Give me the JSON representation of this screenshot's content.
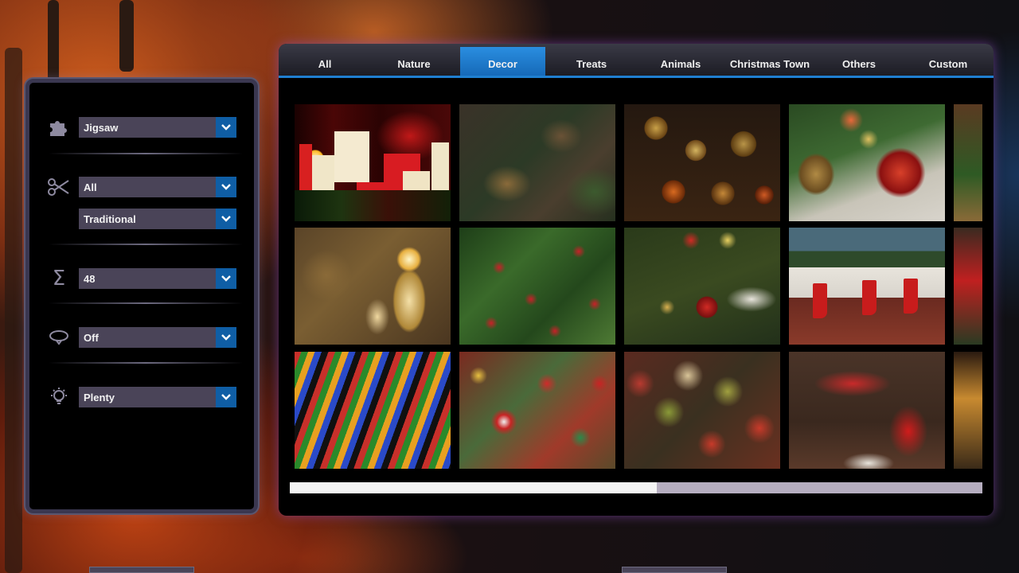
{
  "settings": {
    "mode": {
      "icon": "puzzle-piece-icon",
      "value": "Jigsaw"
    },
    "cut_group": {
      "icon": "scissors-icon",
      "value": "All"
    },
    "cut_style": {
      "value": "Traditional"
    },
    "pieces": {
      "icon": "sigma-icon",
      "value": "48"
    },
    "rotation": {
      "icon": "rotate-icon",
      "value": "Off"
    },
    "hints": {
      "icon": "lightbulb-icon",
      "value": "Plenty"
    }
  },
  "tabs": [
    {
      "label": "All",
      "active": false
    },
    {
      "label": "Nature",
      "active": false
    },
    {
      "label": "Decor",
      "active": true
    },
    {
      "label": "Treats",
      "active": false
    },
    {
      "label": "Animals",
      "active": false
    },
    {
      "label": "Christmas Town",
      "active": false
    },
    {
      "label": "Others",
      "active": false
    },
    {
      "label": "Custom",
      "active": false
    }
  ],
  "puzzles": [
    {
      "name": "candles-poinsettia"
    },
    {
      "name": "pinecone-wreath"
    },
    {
      "name": "hanging-ornaments"
    },
    {
      "name": "ornament-and-pinecones"
    },
    {
      "name": "basket"
    },
    {
      "name": "golden-candles"
    },
    {
      "name": "holly-berries"
    },
    {
      "name": "tree-baubles"
    },
    {
      "name": "fireplace-stockings"
    },
    {
      "name": "nutcracker"
    },
    {
      "name": "colored-lights"
    },
    {
      "name": "ornament-pile"
    },
    {
      "name": "baubles-and-stars"
    },
    {
      "name": "stocking-and-gifts"
    },
    {
      "name": "christmas-village"
    }
  ],
  "scroll_progress": 0.53,
  "colors": {
    "accent": "#1f7fd0",
    "dropdown": "#4a4458",
    "dropdown_arrow": "#0f5ea5"
  }
}
